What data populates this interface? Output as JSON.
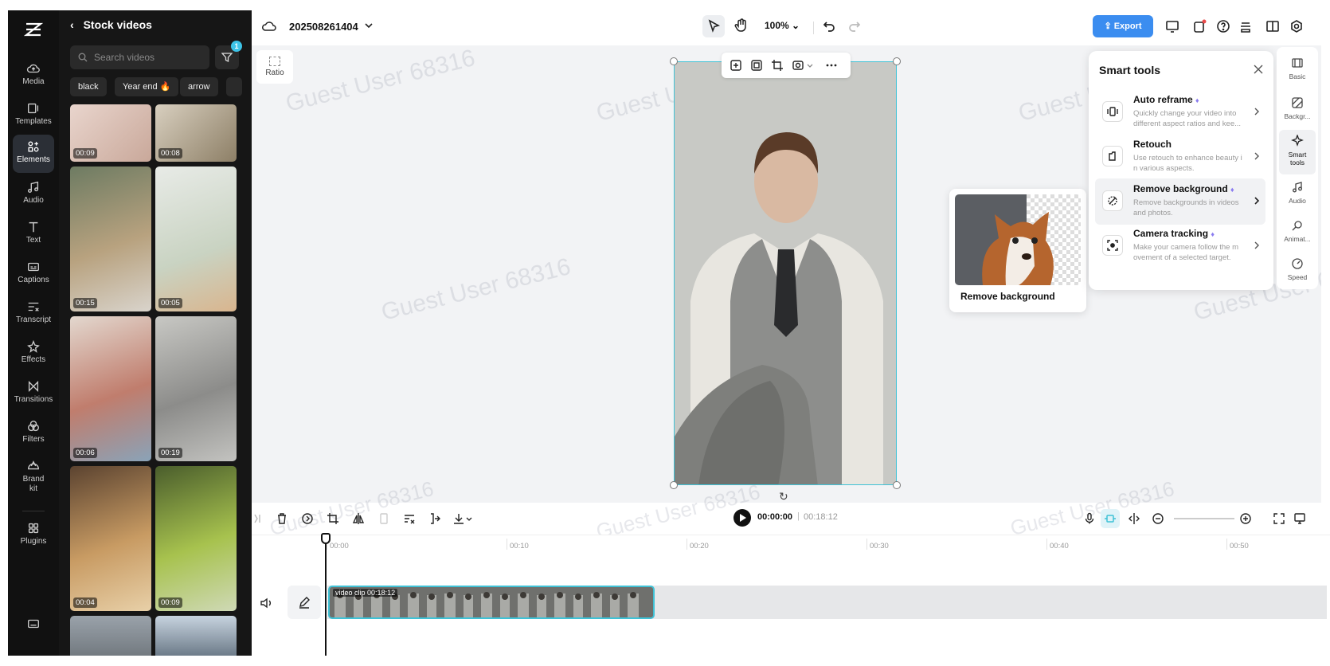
{
  "rail": {
    "items": [
      {
        "label": "Media",
        "icon": "cloud-icon"
      },
      {
        "label": "Templates",
        "icon": "templates-icon"
      },
      {
        "label": "Elements",
        "icon": "elements-icon"
      },
      {
        "label": "Audio",
        "icon": "music-icon"
      },
      {
        "label": "Text",
        "icon": "text-icon"
      },
      {
        "label": "Captions",
        "icon": "captions-icon"
      },
      {
        "label": "Transcript",
        "icon": "transcript-icon"
      },
      {
        "label": "Effects",
        "icon": "effects-icon"
      },
      {
        "label": "Transitions",
        "icon": "transitions-icon"
      },
      {
        "label": "Filters",
        "icon": "filters-icon"
      },
      {
        "label": "Brand kit",
        "icon": "brand-kit-icon"
      },
      {
        "label": "Plugins",
        "icon": "plugins-icon"
      }
    ],
    "active": "Elements"
  },
  "panel": {
    "title": "Stock videos",
    "search_placeholder": "Search videos",
    "filter_badge": "1",
    "chips": [
      "black",
      "Year end 🔥",
      "arrow"
    ],
    "durations": [
      "00:09",
      "00:08",
      "00:15",
      "00:05",
      "00:06",
      "00:19",
      "00:04",
      "00:09"
    ]
  },
  "topbar": {
    "project_name": "202508261404",
    "zoom": "100%",
    "export_label": "Export"
  },
  "canvas": {
    "ratio_label": "Ratio",
    "watermark": "Guest User 68316"
  },
  "remove_bg_popup": {
    "label": "Remove background"
  },
  "smart_tools": {
    "title": "Smart tools",
    "tools": [
      {
        "name": "Auto reframe",
        "desc": "Quickly change your video into different aspect ratios and kee..."
      },
      {
        "name": "Retouch",
        "desc": "Use retouch to enhance beauty i n various aspects."
      },
      {
        "name": "Remove background",
        "desc": "Remove backgrounds in videos and photos."
      },
      {
        "name": "Camera tracking",
        "desc": "Make your camera follow the m ovement of a selected target."
      }
    ]
  },
  "right_props": [
    "Basic",
    "Backgr...",
    "Smart tools",
    "Audio",
    "Animat...",
    "Speed"
  ],
  "timeline": {
    "current_time": "00:00:00",
    "total_time": "00:18:12",
    "ticks": [
      "00:00",
      "00:10",
      "00:20",
      "00:30",
      "00:40",
      "00:50"
    ],
    "clip_label": "video clip",
    "clip_duration": "00:18:12"
  },
  "colors": {
    "accent": "#3b8df0",
    "selection": "#3fc2d6",
    "rail_bg": "#111111"
  }
}
